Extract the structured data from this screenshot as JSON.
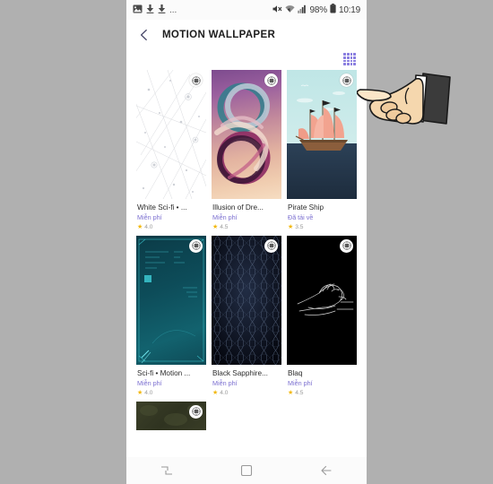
{
  "statusbar": {
    "left_icons": [
      "image-icon",
      "download-icon",
      "download-icon"
    ],
    "overflow": "...",
    "right_icons": [
      "mute-icon",
      "wifi-icon",
      "signal-icon"
    ],
    "battery_percent": "98%",
    "time": "10:19"
  },
  "header": {
    "back_label": "back-chevron",
    "title": "MOTION WALLPAPER"
  },
  "toolbar": {
    "grid_toggle_label": "grid-view",
    "grid_color": "#8a7ee0"
  },
  "grid": {
    "rows": [
      [
        {
          "title": "White Sci-fi • ...",
          "price": "Miễn phí",
          "rating": "4.0",
          "art": "art-white",
          "badge": "motion-badge"
        },
        {
          "title": "Illusion of Dre...",
          "price": "Miễn phí",
          "rating": "4.5",
          "art": "art-illusion",
          "badge": "motion-badge"
        },
        {
          "title": "Pirate Ship",
          "price": "Đã tải về",
          "rating": "3.5",
          "art": "art-pirate",
          "badge": "motion-badge"
        }
      ],
      [
        {
          "title": "Sci-fi • Motion ...",
          "price": "Miễn phí",
          "rating": "4.0",
          "art": "art-scifi",
          "badge": "motion-badge"
        },
        {
          "title": "Black Sapphire...",
          "price": "Miễn phí",
          "rating": "4.0",
          "art": "art-sapphire",
          "badge": "motion-badge"
        },
        {
          "title": "Blaq",
          "price": "Miễn phí",
          "rating": "4.5",
          "art": "art-blaq",
          "badge": "motion-badge"
        }
      ]
    ],
    "partial_item": {
      "art": "art-olive",
      "badge": "motion-badge"
    },
    "star_color": "#f2b705",
    "price_color": "#7b6fd0"
  },
  "navbar": {
    "recents_label": "recent-apps",
    "home_label": "home",
    "back_label": "back"
  },
  "cursor": {
    "label": "pointing-hand-cursor"
  }
}
